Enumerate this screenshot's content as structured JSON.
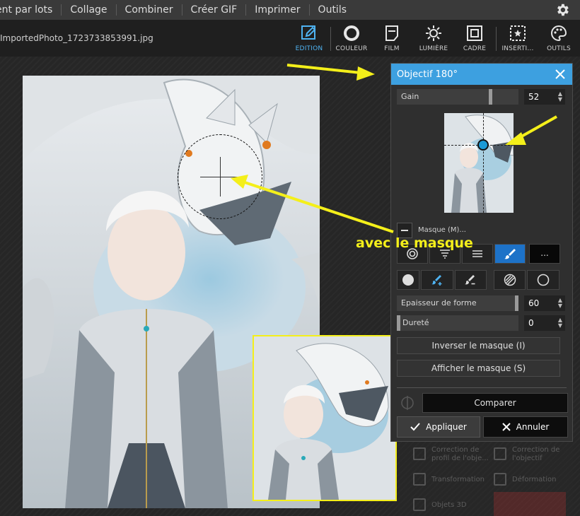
{
  "menu": {
    "items": [
      "ent par lots",
      "Collage",
      "Combiner",
      "Créer GIF",
      "Imprimer",
      "Outils"
    ]
  },
  "toolbar": {
    "filename": "ImportedPhoto_1723733853991.jpg",
    "tools": [
      {
        "label": "EDITION",
        "icon": "edit-icon",
        "active": true
      },
      {
        "label": "COULEUR",
        "icon": "color-circle-icon"
      },
      {
        "label": "FILM",
        "icon": "film-icon"
      },
      {
        "label": "LUMIÈRE",
        "icon": "sun-icon"
      },
      {
        "label": "CADRE",
        "icon": "frame-icon"
      },
      {
        "label": "INSERTI...",
        "icon": "insert-star-icon"
      },
      {
        "label": "OUTILS",
        "icon": "palette-icon"
      }
    ]
  },
  "panel": {
    "title": "Objectif 180°",
    "gain": {
      "label": "Gain",
      "value": "52",
      "level": 0.52
    },
    "mask_label": "Masque (M)...",
    "more_label": "...",
    "shape_thickness": {
      "label": "Epaisseur de forme",
      "value": "60",
      "level": 0.97
    },
    "hardness": {
      "label": "Dureté",
      "value": "0",
      "level": 0.0
    },
    "invert_mask": "Inverser le masque (I)",
    "show_mask": "Afficher le masque (S)",
    "compare": "Comparer",
    "apply": "Appliquer",
    "cancel": "Annuler"
  },
  "underpanel": {
    "items": [
      "Correction de profil de l'obje...",
      "Correction de l'objectif",
      "Transformation",
      "Déformation",
      "Objets 3D"
    ]
  },
  "annotation": {
    "text": "avec le masque",
    "color": "#f4ef1a"
  },
  "colors": {
    "accent": "#3da0e0",
    "active_tool": "#1d72c8",
    "highlight": "#f4ef1a"
  }
}
